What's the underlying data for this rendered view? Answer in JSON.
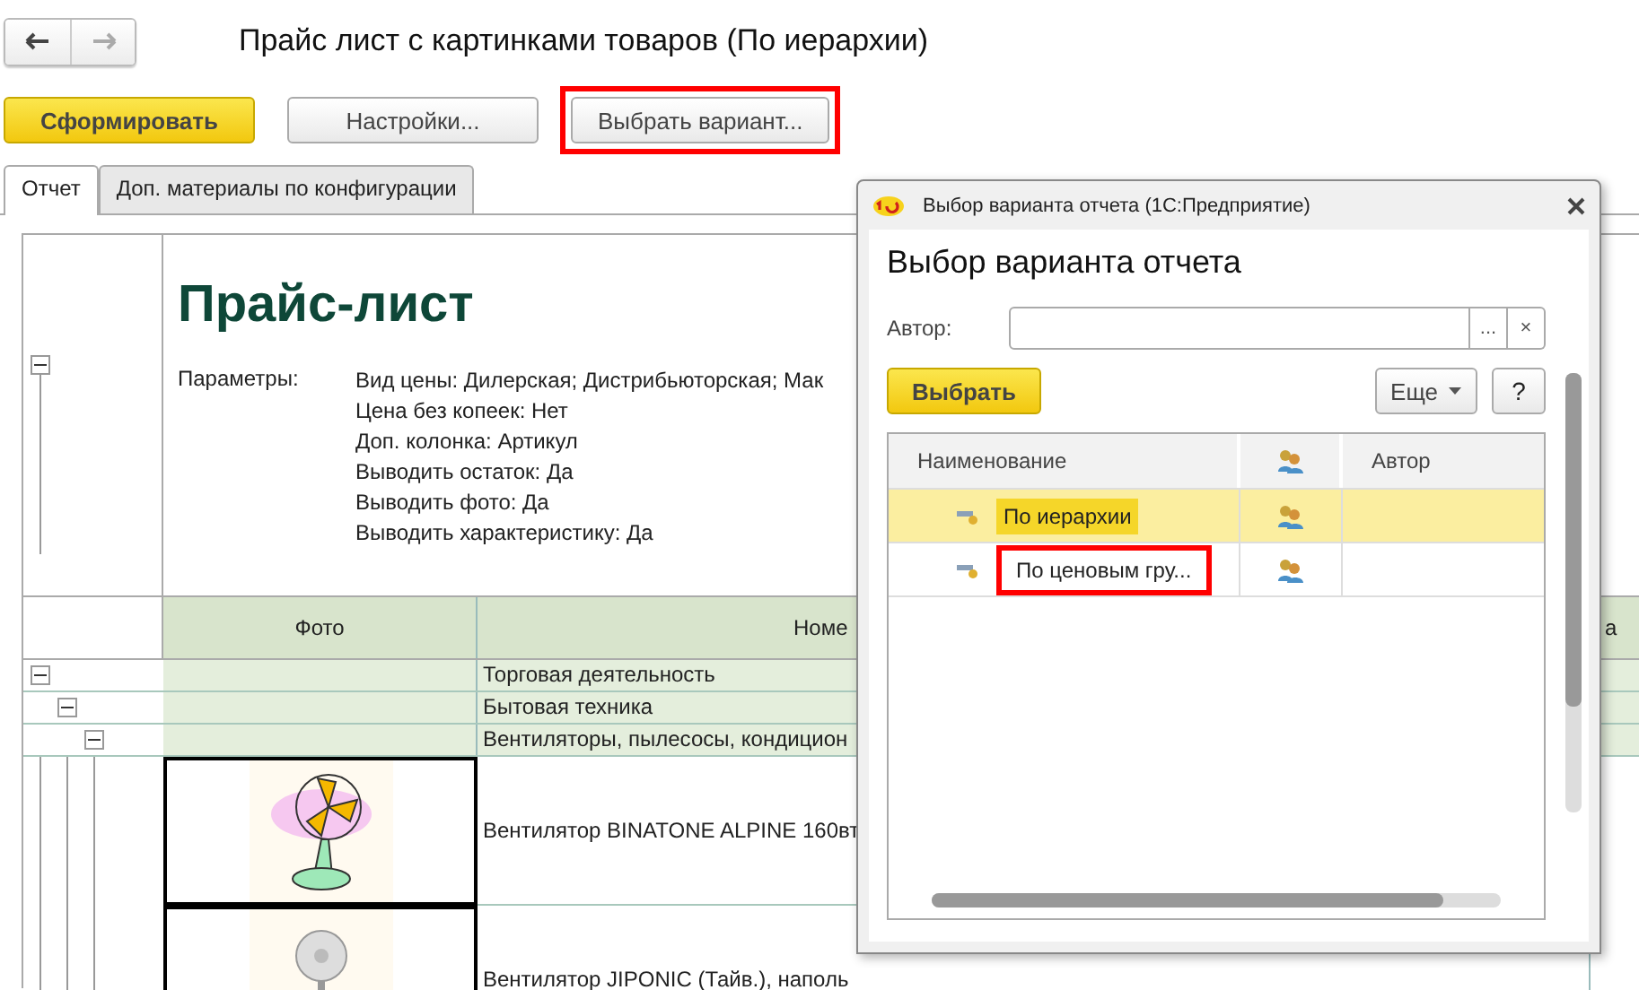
{
  "window": {
    "title": "Прайс лист с картинками товаров (По иерархии)"
  },
  "nav": [
    {
      "kind": "back",
      "disabled": false
    },
    {
      "kind": "forward",
      "disabled": true
    }
  ],
  "toolbar": [
    {
      "label": "Сформировать",
      "kind": "primary",
      "highlighted": false
    },
    {
      "label": "Настройки...",
      "kind": "normal",
      "highlighted": false
    },
    {
      "label": "Выбрать вариант...",
      "kind": "normal",
      "highlighted": true
    }
  ],
  "tabs": [
    {
      "label": "Отчет",
      "selected": true
    },
    {
      "label": "Доп. материалы по конфигурации",
      "selected": false
    }
  ],
  "report": {
    "title": "Прайс-лист",
    "params_label": "Параметры:",
    "params": [
      "Вид цены: Дилерская; Дистрибьюторская; Мак",
      "Цена без копеек: Нет",
      "Доп. колонка: Артикул",
      "Выводить остаток: Да",
      "Выводить фото: Да",
      "Выводить характеристику: Да"
    ],
    "columns": [
      "Фото",
      "Номе",
      "а"
    ],
    "groups": [
      {
        "name": "Торговая деятельность",
        "expanded": true,
        "children": [
          {
            "name": "Бытовая техника",
            "expanded": true,
            "children": [
              {
                "name": "Вентиляторы, пылесосы, кондицион",
                "expanded": true
              }
            ]
          }
        ]
      }
    ],
    "products": [
      {
        "name": "Вентилятор BINATONE ALPINE 160вт",
        "kind": "table-fan"
      },
      {
        "name": "Вентилятор JIPONIC (Тайв.), наполь",
        "kind": "floor-fan"
      }
    ]
  },
  "dialog": {
    "title": "Выбор варианта отчета  (1С:Предприятие)",
    "heading": "Выбор варианта отчета",
    "author_label": "Автор:",
    "field_buttons": [
      "...",
      "×"
    ],
    "select_button": "Выбрать",
    "more_button": "Еще",
    "help_button": "?",
    "columns": [
      "Наименование",
      "Автор"
    ],
    "variants": [
      {
        "name": "По иерархии",
        "selected": true,
        "highlighted": false
      },
      {
        "name": "По ценовым гру...",
        "selected": false,
        "highlighted": true
      }
    ]
  }
}
